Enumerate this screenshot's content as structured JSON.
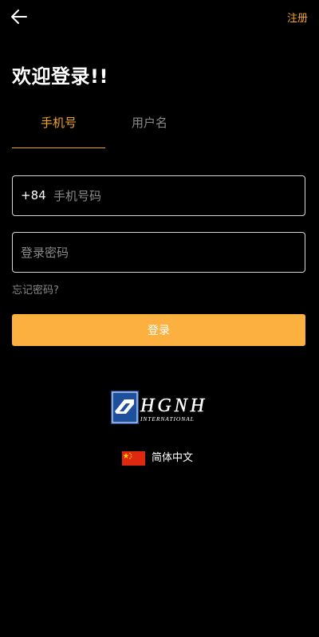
{
  "header": {
    "back_icon": "arrow-left-icon",
    "register_label": "注册"
  },
  "page": {
    "title": "欢迎登录!!"
  },
  "tabs": [
    {
      "label": "手机号",
      "active": true
    },
    {
      "label": "用户名",
      "active": false
    }
  ],
  "form": {
    "country_code": "+84",
    "phone_placeholder": "手机号码",
    "phone_value": "",
    "password_placeholder": "登录密码",
    "password_value": "",
    "forgot_label": "忘记密码?",
    "login_label": "登录"
  },
  "brand": {
    "logo_main_text": "HGNH",
    "logo_sub_text": "INTERNATIONAL"
  },
  "language": {
    "flag_icon": "china-flag-icon",
    "label": "简体中文"
  },
  "colors": {
    "background": "#000000",
    "accent": "#f5a623",
    "button": "#fbb040",
    "muted_text": "#8a8a8a",
    "border": "#d9d9d9"
  }
}
